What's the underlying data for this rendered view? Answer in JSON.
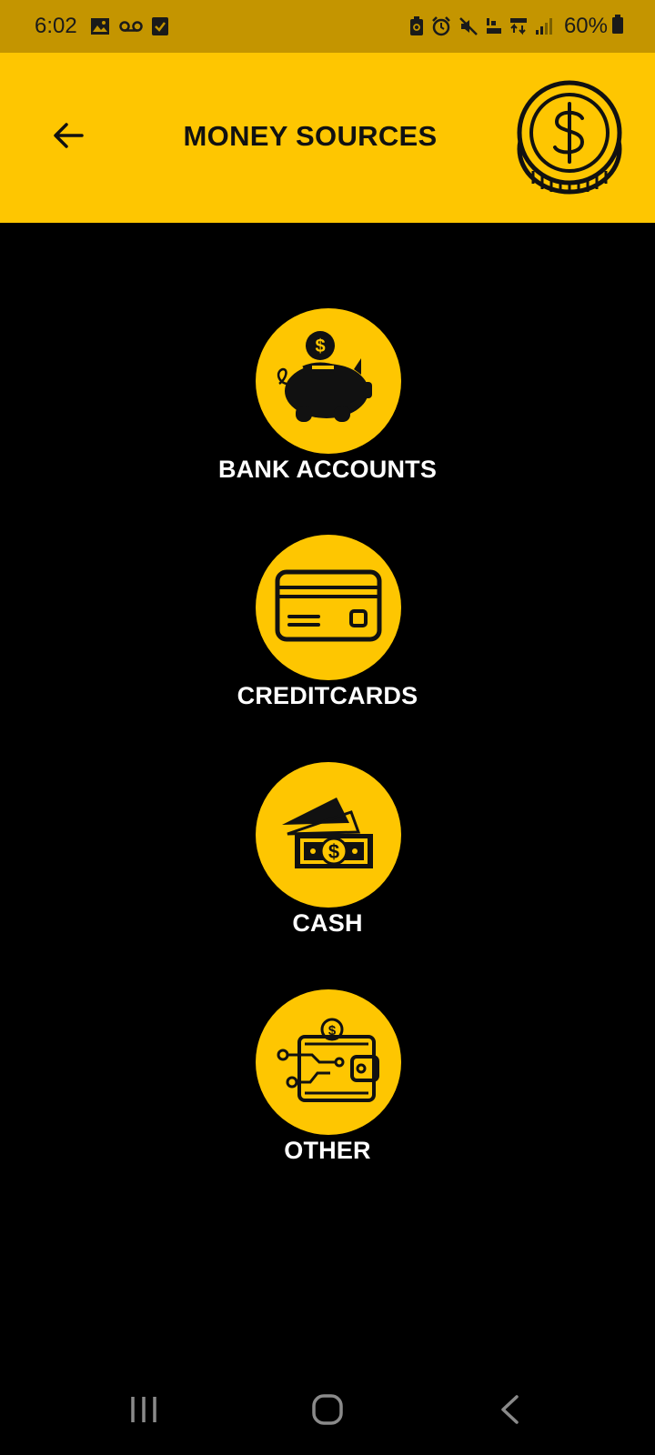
{
  "status_bar": {
    "time": "6:02",
    "battery": "60%",
    "left_icons": [
      "image-icon",
      "voicemail-icon",
      "checkbox-icon"
    ],
    "right_icons": [
      "battery-saver-icon",
      "alarm-icon",
      "mute-icon",
      "volte-icon",
      "4g-lte-icon",
      "signal-icon",
      "battery-icon"
    ]
  },
  "header": {
    "title": "MONEY SOURCES",
    "back_icon": "arrow-left-icon",
    "logo_icon": "dollar-coin-icon"
  },
  "menu": {
    "items": [
      {
        "label": "BANK ACCOUNTS",
        "icon": "piggy-bank-icon"
      },
      {
        "label": "CREDITCARDS",
        "icon": "credit-card-icon"
      },
      {
        "label": "CASH",
        "icon": "cash-bills-icon"
      },
      {
        "label": "OTHER",
        "icon": "digital-wallet-icon"
      }
    ]
  },
  "colors": {
    "accent": "#FEC601",
    "status_bar": "#C49500",
    "background": "#000000",
    "label_text": "#FFFFFF"
  },
  "nav_bar": {
    "icons": [
      "recent-apps-icon",
      "home-icon",
      "back-icon"
    ]
  }
}
